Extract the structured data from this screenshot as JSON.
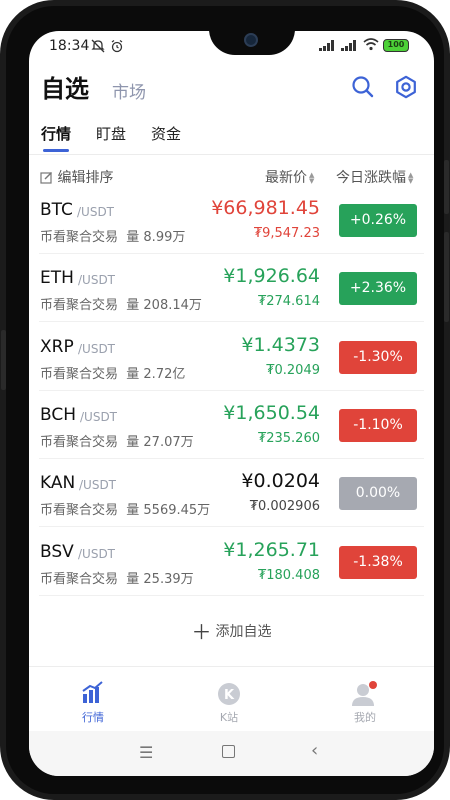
{
  "status_bar": {
    "time": "18:34",
    "battery": "100"
  },
  "header": {
    "title": "自选",
    "subtitle": "市场"
  },
  "tabs": [
    {
      "label": "行情",
      "active": true
    },
    {
      "label": "盯盘",
      "active": false
    },
    {
      "label": "资金",
      "active": false
    }
  ],
  "columns": {
    "edit": "编辑排序",
    "price": "最新价",
    "change": "今日涨跌幅"
  },
  "colors": {
    "up_green": "#27a25a",
    "down_red": "#e0443a",
    "neutral_gray": "#a6a9b1",
    "accent_blue": "#3d63d6",
    "price_red": "#e0443a",
    "price_green": "#27a25a",
    "price_black": "#111111"
  },
  "rows": [
    {
      "symbol": "BTC",
      "quote": "/USDT",
      "source": "币看聚合交易",
      "volume": "量 8.99万",
      "price": "¥66,981.45",
      "fiat": "₮9,547.23",
      "change": "+0.26%",
      "price_color": "red",
      "change_color": "green"
    },
    {
      "symbol": "ETH",
      "quote": "/USDT",
      "source": "币看聚合交易",
      "volume": "量 208.14万",
      "price": "¥1,926.64",
      "fiat": "₮274.614",
      "change": "+2.36%",
      "price_color": "green",
      "change_color": "green"
    },
    {
      "symbol": "XRP",
      "quote": "/USDT",
      "source": "币看聚合交易",
      "volume": "量 2.72亿",
      "price": "¥1.4373",
      "fiat": "₮0.2049",
      "change": "-1.30%",
      "price_color": "green",
      "change_color": "red"
    },
    {
      "symbol": "BCH",
      "quote": "/USDT",
      "source": "币看聚合交易",
      "volume": "量 27.07万",
      "price": "¥1,650.54",
      "fiat": "₮235.260",
      "change": "-1.10%",
      "price_color": "green",
      "change_color": "red"
    },
    {
      "symbol": "KAN",
      "quote": "/USDT",
      "source": "币看聚合交易",
      "volume": "量 5569.45万",
      "price": "¥0.0204",
      "fiat": "₮0.002906",
      "change": "0.00%",
      "price_color": "black",
      "change_color": "gray"
    },
    {
      "symbol": "BSV",
      "quote": "/USDT",
      "source": "币看聚合交易",
      "volume": "量 25.39万",
      "price": "¥1,265.71",
      "fiat": "₮180.408",
      "change": "-1.38%",
      "price_color": "green",
      "change_color": "red"
    }
  ],
  "add_label": "添加自选",
  "bottom_nav": [
    {
      "label": "行情",
      "icon": "chart-bars-icon",
      "active": true
    },
    {
      "label": "K站",
      "icon": "k-circle-icon",
      "active": false
    },
    {
      "label": "我的",
      "icon": "user-icon",
      "active": false
    }
  ]
}
